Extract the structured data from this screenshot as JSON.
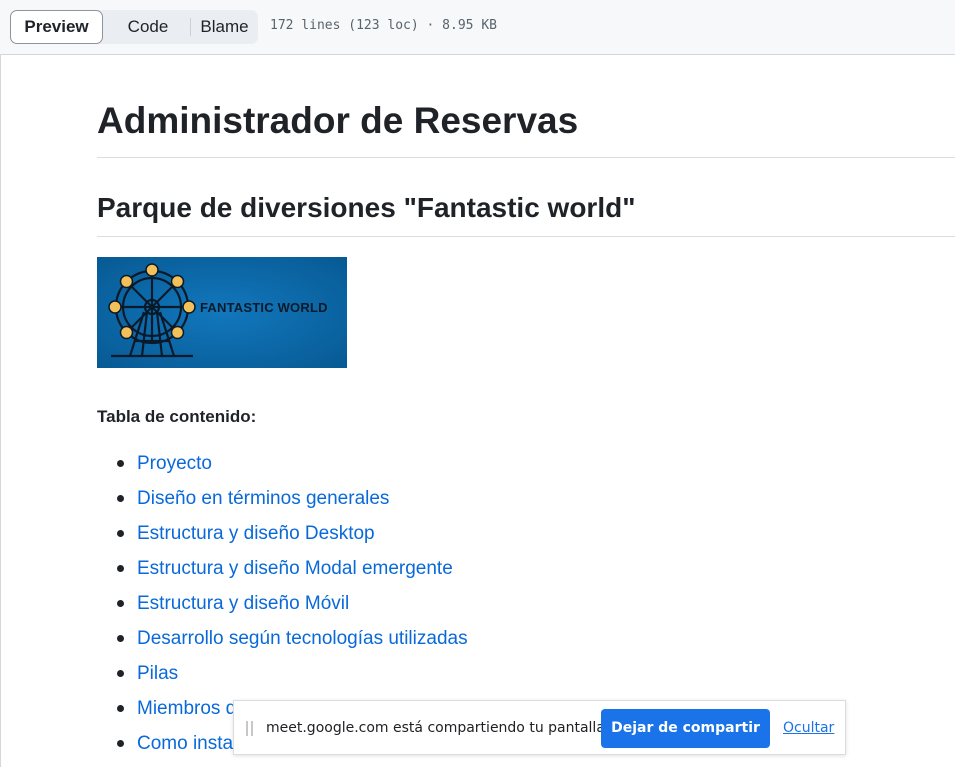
{
  "toolbar": {
    "tabs": [
      {
        "label": "Preview",
        "selected": true
      },
      {
        "label": "Code",
        "selected": false
      },
      {
        "label": "Blame",
        "selected": false
      }
    ],
    "file_meta": "172 lines (123 loc) · 8.95 KB"
  },
  "readme": {
    "title": "Administrador de Reservas",
    "subtitle": "Parque de diversiones \"Fantastic world\"",
    "logo": {
      "text": "FANTASTIC WORLD",
      "icon": "ferris-wheel-icon",
      "background_color": "#0a68a8"
    },
    "toc_label": "Tabla de contenido:",
    "toc_items": [
      "Proyecto",
      "Diseño en términos generales",
      "Estructura y diseño Desktop",
      "Estructura y diseño Modal emergente",
      "Estructura y diseño Móvil",
      "Desarrollo según tecnologías utilizadas",
      "Pilas",
      "Miembros del grupo",
      "Como instalar este proyecto"
    ],
    "link_color": "#0969da"
  },
  "share_bar": {
    "message": "meet.google.com está compartiendo tu pantalla.",
    "stop_button": "Dejar de compartir",
    "hide_link": "Ocultar",
    "accent_color": "#1a73e8"
  }
}
